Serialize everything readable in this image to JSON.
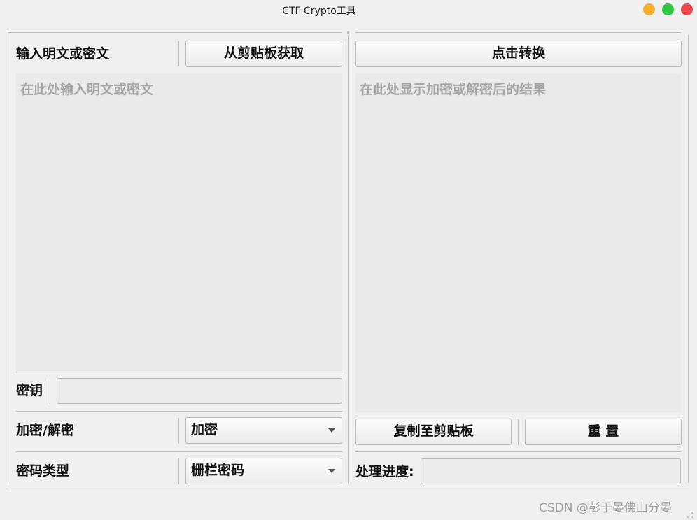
{
  "window": {
    "title": "CTF Crypto工具"
  },
  "left": {
    "input_label": "输入明文或密文",
    "paste_button": "从剪贴板获取",
    "input_placeholder": "在此处输入明文或密文",
    "key_label": "密钥",
    "key_value": "",
    "mode_label": "加密/解密",
    "mode_selected": "加密",
    "cipher_label": "密码类型",
    "cipher_selected": "栅栏密码"
  },
  "right": {
    "convert_button": "点击转换",
    "output_placeholder": "在此处显示加密或解密后的结果",
    "copy_button": "复制至剪贴板",
    "reset_button": "重 置",
    "progress_label": "处理进度:"
  },
  "watermark": "CSDN @彭于晏佛山分晏",
  "colors": {
    "minimize": "#f6b12b",
    "maximize": "#2fc640",
    "close": "#f3474b"
  }
}
